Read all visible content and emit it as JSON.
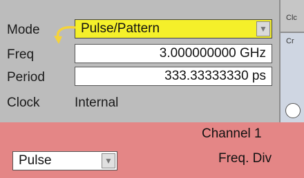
{
  "settings": {
    "mode_label": "Mode",
    "mode_value": "Pulse/Pattern",
    "freq_label": "Freq",
    "freq_value": "3.000000000 GHz",
    "period_label": "Period",
    "period_value": "333.33333330 ps",
    "clock_label": "Clock",
    "clock_value": "Internal"
  },
  "right_panel": {
    "top_text": "Clc",
    "mid_text": "Cr"
  },
  "channel": {
    "title": "Channel 1",
    "type_value": "Pulse",
    "freq_div_label": "Freq. Div"
  },
  "colors": {
    "panel_bg": "#bcbcbc",
    "mode_highlight": "#f5f02a",
    "channel_bg": "#e48686",
    "arrow": "#f5d33a"
  },
  "icons": {
    "dropdown": "chevron-down-icon",
    "link_arrow": "curved-arrow-icon"
  }
}
